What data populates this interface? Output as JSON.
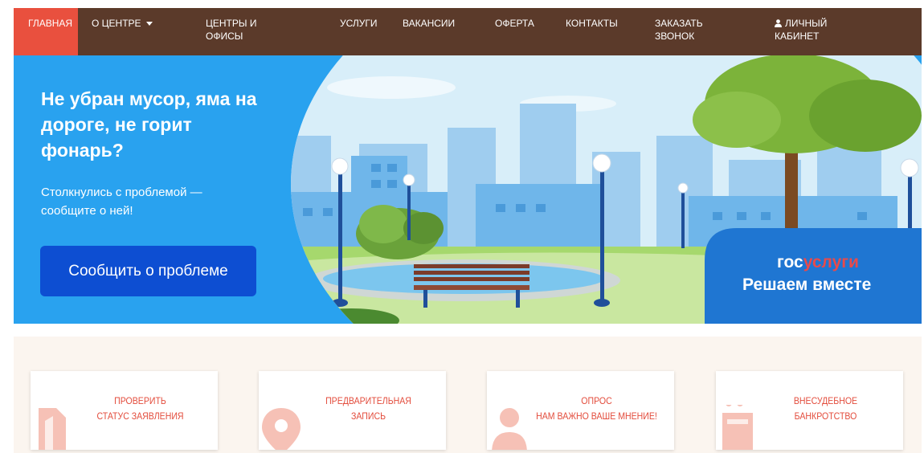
{
  "nav": {
    "items": [
      {
        "label": "Главная",
        "active": true
      },
      {
        "label": "О центре"
      },
      {
        "label": "Центры и офисы"
      },
      {
        "label": "Услуги"
      },
      {
        "label": "Вакансии"
      },
      {
        "label": "Оферта"
      },
      {
        "label": "Контакты"
      },
      {
        "label": "Заказать звонок"
      },
      {
        "label": "Личный кабинет"
      }
    ]
  },
  "banner": {
    "title": "Не убран мусор, яма на дороге, не горит фонарь?",
    "subtitle": "Столкнулись с проблемой — сообщите о ней!",
    "button_label": "Сообщить о проблеме",
    "logo_part1": "гос",
    "logo_part2": "услуги",
    "slogan": "Решаем вместе"
  },
  "cards": [
    {
      "line1": "Проверить",
      "line2": "статус заявления"
    },
    {
      "line1": "Предварительная",
      "line2": "запись"
    },
    {
      "line1": "Опрос",
      "line2": "нам важно ваше мнение!"
    },
    {
      "line1": "Внесудебное",
      "line2": "банкротство"
    }
  ],
  "colors": {
    "nav_bg": "#5b3a2a",
    "nav_active": "#e9503e",
    "banner_bg": "#29a2ef",
    "button_bg": "#0d4ed2",
    "card_text": "#e34c3c"
  }
}
